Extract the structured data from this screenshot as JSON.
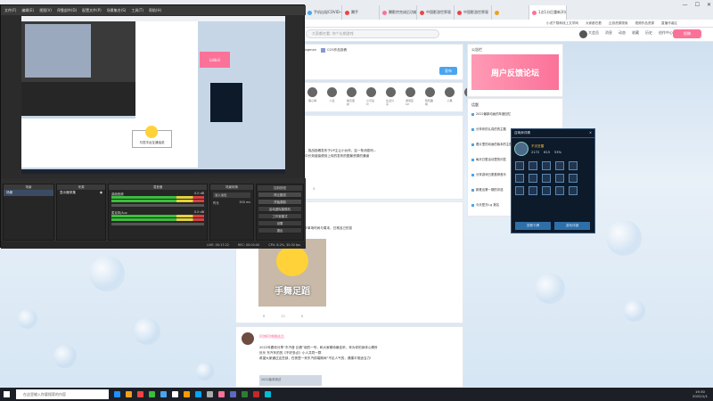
{
  "browser": {
    "tabs": [
      {
        "label": "CF高能打全",
        "color": "#f0a020"
      },
      {
        "label": "手机出现COVID-4",
        "color": "#4aa5f0"
      },
      {
        "label": "腾手",
        "color": "#e44"
      },
      {
        "label": "腾影宗完成后功能",
        "color": "#fb7299"
      },
      {
        "label": "中国影游世界观",
        "color": "#e44"
      },
      {
        "label": "中国影游世界观",
        "color": "#e44"
      },
      {
        "label": "",
        "color": "#f0a020"
      },
      {
        "label": "1点1分后重新开始 (1 卷 5)",
        "color": "#fb7299"
      }
    ],
    "bookmarks": [
      "小说下载和线上文学网",
      "大家都在看",
      "云游资源搜索",
      "视频作品资源",
      "直播作者区"
    ],
    "search_placeholder": "大家都在看: 你个长期游戏",
    "nav": [
      "大会员",
      "消息",
      "动态",
      "收藏",
      "历史",
      "创作中心"
    ],
    "post_button": "投稿"
  },
  "feed": {
    "flair": [
      "Bilibili游戏中心合集",
      "游戏中二的flagman",
      "COS作品投稿"
    ],
    "send_label": "发布",
    "avatars": [
      "萌心驿",
      "小吕",
      "每天更新",
      "小可爱吖",
      "生活分享",
      "游戏区UP",
      "知晓趣味",
      "小黑",
      "热门"
    ],
    "post1_lines": [
      "活动，挑战投稿发布于UP主让小伙伴，这一条消息吗...",
      "可能中长效链接便到上传的发布的图景资源的通道"
    ],
    "post1_stats": [
      "8",
      "8"
    ],
    "post2_lines": [
      "在一个特别开放的行星开动，同步单场时间与周末，日常自己的变"
    ],
    "emoji_caption": "手舞足蹈",
    "post2_stats": [
      "8",
      "12",
      "6"
    ],
    "post3_author": "阿博阿博播放品",
    "post3_lines": [
      "2022年跟你分享“东汽音 比赛”用的一号，和大家期待最佳听，来为你的身体心情所",
      "处乐 东汽车的的《不好多点》小人共同一群",
      "希望大家通过这些部，在夜里一来东汽前端期间“不见人气的，健康平常适当力!"
    ],
    "post3_thumb_label": "2022版本测试"
  },
  "sidebar": {
    "banner_title": "公告栏",
    "banner_text": "周户反馈论坛",
    "list_title": "话题",
    "items": [
      "2022最新动画的年度回忆",
      "分享你的认真的的主题",
      "看片里的动画的版本的主题",
      "每天日更活动里的问答",
      "分享游戏日更推荐音乐",
      "新推出第一期的评选",
      "今天是万t-g 报名"
    ]
  },
  "game_panel": {
    "title": "召唤师详情",
    "name": "不灭狂雷",
    "stats": [
      "2172",
      "615",
      "53%"
    ],
    "btn_left": "查看卡牌",
    "btn_right": "游戏详细"
  },
  "obs": {
    "menu": [
      "文件(F)",
      "编辑(E)",
      "视图(V)",
      "停靠部件(D)",
      "配置文件(P)",
      "场景集合(S)",
      "工具(T)",
      "帮助(H)"
    ],
    "tip_text": "与您平台互通话说",
    "docks": [
      "场景",
      "来源",
      "混音器",
      "场景转换",
      "控制按钮"
    ],
    "scene": "场景",
    "source": "显示器采集",
    "mixer_tracks": [
      "桌面音频",
      "麦克风/Aux"
    ],
    "mixer_db": [
      "0.0 dB",
      "0.0 dB"
    ],
    "transition": "淡入淡出",
    "duration_label": "时长",
    "duration": "300 ms",
    "controls": [
      "停止推流",
      "开始录制",
      "启动虚拟摄像机",
      "工作室模式",
      "设置",
      "退出"
    ],
    "status": [
      "LIVE: 00:17:22",
      "REC: 00:00:00",
      "CPU: 8.2%, 30.00 fps"
    ]
  },
  "taskbar": {
    "search": "在这里输入你要搜索的内容",
    "time": "19:30",
    "date": "2022/1/1",
    "icon_colors": [
      "#1e90ff",
      "#f0a020",
      "#e44",
      "#3dbd3d",
      "#4aa5f0",
      "#fff",
      "#ff9900",
      "#00a4ff",
      "#aaa",
      "#fb7299",
      "#5c6bc0",
      "#2e7d32",
      "#c62828",
      "#00bcd4"
    ]
  }
}
